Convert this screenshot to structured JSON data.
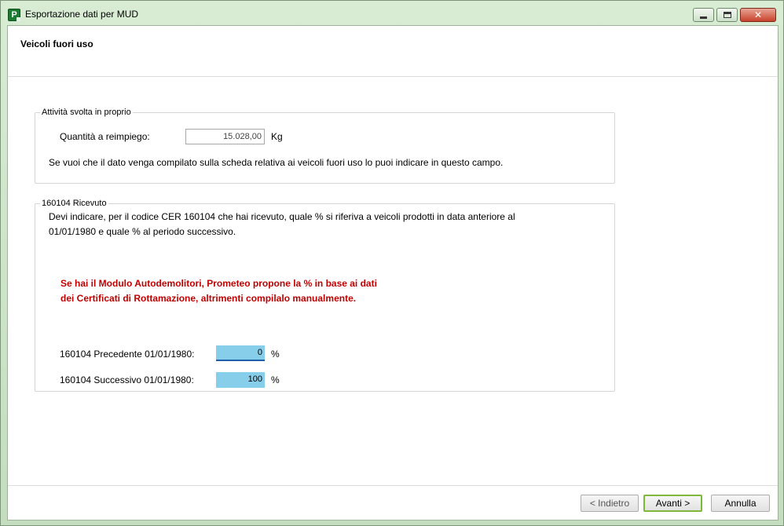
{
  "window": {
    "title": "Esportazione dati per MUD",
    "icon": "app-icon",
    "controls": {
      "minimize": "minimize-icon",
      "maximize": "maximize-icon",
      "close": "close-icon"
    }
  },
  "page": {
    "title": "Veicoli fuori uso"
  },
  "group_proprio": {
    "legend": "Attività svolta in proprio",
    "quantity_label": "Quantità a reimpiego:",
    "quantity_value": "15.028,00",
    "quantity_unit": "Kg",
    "hint": "Se vuoi che il dato venga compilato sulla scheda relativa ai veicoli fuori uso lo puoi indicare in questo campo."
  },
  "group_ricevuto": {
    "legend": "160104 Ricevuto",
    "description_line1": "Devi indicare, per il codice CER 160104 che hai ricevuto, quale % si riferiva a veicoli prodotti in data anteriore al",
    "description_line2": "01/01/1980 e quale % al periodo successivo.",
    "warning_line1": "Se hai il Modulo Autodemolitori, Prometeo propone la % in base ai dati",
    "warning_line2": "dei Certificati di Rottamazione, altrimenti compilalo manualmente.",
    "precedente_label": "160104 Precedente 01/01/1980:",
    "precedente_value": "0",
    "successivo_label": "160104 Successivo 01/01/1980:",
    "successivo_value": "100",
    "percent": "%"
  },
  "buttons": {
    "back": "< Indietro",
    "next": "Avanti >",
    "cancel": "Annulla"
  },
  "colors": {
    "field_highlight": "#87ceeb",
    "warning_text": "#c00000",
    "primary_border": "#7fb83a"
  }
}
